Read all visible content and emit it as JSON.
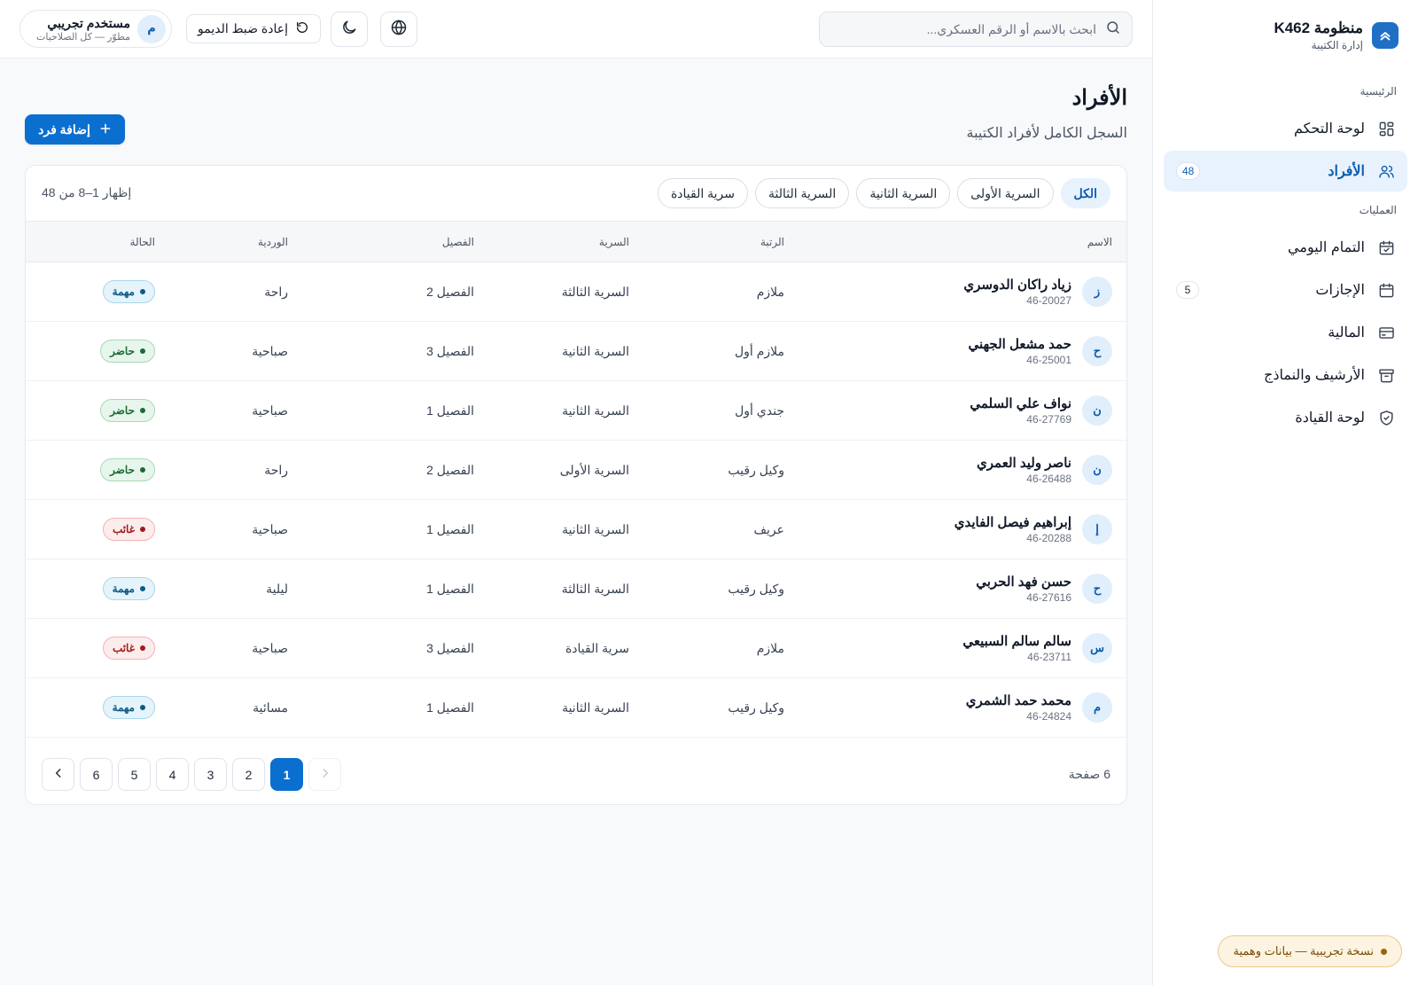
{
  "brand": {
    "title": "منظومة K462",
    "subtitle": "إدارة الكتيبة"
  },
  "nav": {
    "sections": [
      {
        "label": "الرئيسية"
      },
      {
        "label": "العمليات"
      }
    ],
    "items": [
      {
        "label": "لوحة التحكم",
        "icon": "dashboard-icon"
      },
      {
        "label": "الأفراد",
        "icon": "users-icon",
        "badge": "48",
        "active": true
      },
      {
        "label": "التمام اليومي",
        "icon": "calendar-check-icon"
      },
      {
        "label": "الإجازات",
        "icon": "calendar-icon",
        "badge": "5"
      },
      {
        "label": "المالية",
        "icon": "credit-card-icon"
      },
      {
        "label": "الأرشيف والنماذج",
        "icon": "archive-icon"
      },
      {
        "label": "لوحة القيادة",
        "icon": "shield-icon"
      }
    ],
    "demo_notice": "نسخة تجريبية — بيانات وهمية"
  },
  "topbar": {
    "search_placeholder": "ابحث بالاسم أو الرقم العسكري...",
    "reset_label": "إعادة ضبط الديمو",
    "user": {
      "name": "مستخدم تجريبي",
      "role": "مطوّر — كل الصلاحيات",
      "initial": "م"
    }
  },
  "page": {
    "title": "الأفراد",
    "subtitle": "السجل الكامل لأفراد الكتيبة",
    "add_label": "إضافة فرد"
  },
  "filters": [
    "الكل",
    "السرية الأولى",
    "السرية الثانية",
    "السرية الثالثة",
    "سرية القيادة"
  ],
  "showing": "إظهار 1–8 من 48",
  "table": {
    "headers": [
      "الاسم",
      "الرتبة",
      "السرية",
      "الفصيل",
      "الوردية",
      "الحالة"
    ],
    "rows": [
      {
        "initial": "ز",
        "name": "زياد راكان الدوسري",
        "id": "46-20027",
        "rank": "ملازم",
        "company": "السرية الثالثة",
        "platoon": "الفصيل 2",
        "shift": "راحة",
        "status": "مهمة",
        "status_type": "mission"
      },
      {
        "initial": "ح",
        "name": "حمد مشعل الجهني",
        "id": "46-25001",
        "rank": "ملازم أول",
        "company": "السرية الثانية",
        "platoon": "الفصيل 3",
        "shift": "صباحية",
        "status": "حاضر",
        "status_type": "present"
      },
      {
        "initial": "ن",
        "name": "نواف علي السلمي",
        "id": "46-27769",
        "rank": "جندي أول",
        "company": "السرية الثانية",
        "platoon": "الفصيل 1",
        "shift": "صباحية",
        "status": "حاضر",
        "status_type": "present"
      },
      {
        "initial": "ن",
        "name": "ناصر وليد العمري",
        "id": "46-26488",
        "rank": "وكيل رقيب",
        "company": "السرية الأولى",
        "platoon": "الفصيل 2",
        "shift": "راحة",
        "status": "حاضر",
        "status_type": "present"
      },
      {
        "initial": "إ",
        "name": "إبراهيم فيصل الفايدي",
        "id": "46-20288",
        "rank": "عريف",
        "company": "السرية الثانية",
        "platoon": "الفصيل 1",
        "shift": "صباحية",
        "status": "غائب",
        "status_type": "absent"
      },
      {
        "initial": "ح",
        "name": "حسن فهد الحربي",
        "id": "46-27616",
        "rank": "وكيل رقيب",
        "company": "السرية الثالثة",
        "platoon": "الفصيل 1",
        "shift": "ليلية",
        "status": "مهمة",
        "status_type": "mission"
      },
      {
        "initial": "س",
        "name": "سالم سالم السبيعي",
        "id": "46-23711",
        "rank": "ملازم",
        "company": "سرية القيادة",
        "platoon": "الفصيل 3",
        "shift": "صباحية",
        "status": "غائب",
        "status_type": "absent"
      },
      {
        "initial": "م",
        "name": "محمد حمد الشمري",
        "id": "46-24824",
        "rank": "وكيل رقيب",
        "company": "السرية الثانية",
        "platoon": "الفصيل 1",
        "shift": "مسائية",
        "status": "مهمة",
        "status_type": "mission"
      }
    ]
  },
  "pagination": {
    "page_count": "6 صفحة",
    "pages": [
      "1",
      "2",
      "3",
      "4",
      "5",
      "6"
    ],
    "current": "1"
  },
  "colors": {
    "accent": "#0b6fd0",
    "mission": "#0d5b87",
    "present": "#1a6b33",
    "absent": "#9e1b1b"
  }
}
